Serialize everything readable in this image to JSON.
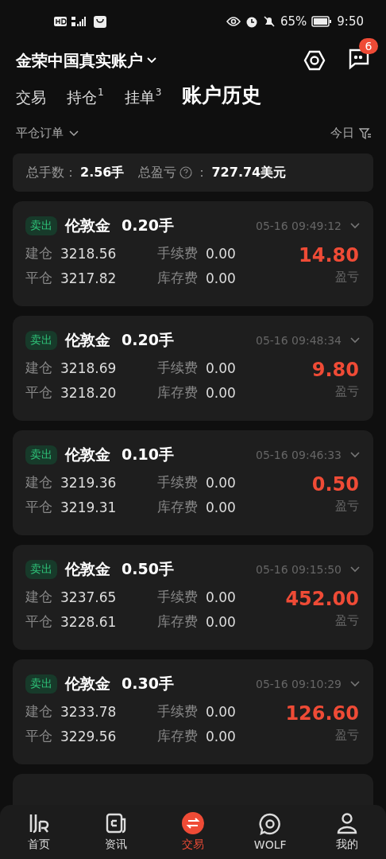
{
  "status_bar": {
    "battery": "65%",
    "time": "9:50"
  },
  "header": {
    "account": "金荣中国真实账户",
    "message_count": "6"
  },
  "tabs": [
    {
      "label": "交易",
      "selected": false
    },
    {
      "label": "持仓",
      "badge": "1",
      "selected": false
    },
    {
      "label": "挂单",
      "badge": "3",
      "selected": false
    },
    {
      "label": "账户历史",
      "selected": true
    }
  ],
  "filter": {
    "order_type": "平仓订单",
    "period": "今日"
  },
  "summary": {
    "lots_label": "总手数：",
    "lots": "2.56手",
    "pnl_label": "总盈亏",
    "pnl_sep": "：",
    "pnl": "727.74美元"
  },
  "orders": [
    {
      "side": "卖出",
      "kind": "sell",
      "symbol": "伦敦金",
      "lots": "0.20手",
      "time": "05-16 09:49:12",
      "open_label": "建仓",
      "open": "3218.56",
      "close_label": "平仓",
      "close": "3217.82",
      "fee_label": "手续费",
      "fee": "0.00",
      "swap_label": "库存费",
      "swap": "0.00",
      "pnl": "14.80",
      "pnl_label": "盈亏"
    },
    {
      "side": "卖出",
      "kind": "sell",
      "symbol": "伦敦金",
      "lots": "0.20手",
      "time": "05-16 09:48:34",
      "open_label": "建仓",
      "open": "3218.69",
      "close_label": "平仓",
      "close": "3218.20",
      "fee_label": "手续费",
      "fee": "0.00",
      "swap_label": "库存费",
      "swap": "0.00",
      "pnl": "9.80",
      "pnl_label": "盈亏"
    },
    {
      "side": "卖出",
      "kind": "sell",
      "symbol": "伦敦金",
      "lots": "0.10手",
      "time": "05-16 09:46:33",
      "open_label": "建仓",
      "open": "3219.36",
      "close_label": "平仓",
      "close": "3219.31",
      "fee_label": "手续费",
      "fee": "0.00",
      "swap_label": "库存费",
      "swap": "0.00",
      "pnl": "0.50",
      "pnl_label": "盈亏"
    },
    {
      "side": "卖出",
      "kind": "sell",
      "symbol": "伦敦金",
      "lots": "0.50手",
      "time": "05-16 09:15:50",
      "open_label": "建仓",
      "open": "3237.65",
      "close_label": "平仓",
      "close": "3228.61",
      "fee_label": "手续费",
      "fee": "0.00",
      "swap_label": "库存费",
      "swap": "0.00",
      "pnl": "452.00",
      "pnl_label": "盈亏"
    },
    {
      "side": "卖出",
      "kind": "sell",
      "symbol": "伦敦金",
      "lots": "0.30手",
      "time": "05-16 09:10:29",
      "open_label": "建仓",
      "open": "3233.78",
      "close_label": "平仓",
      "close": "3229.56",
      "fee_label": "手续费",
      "fee": "0.00",
      "swap_label": "库存费",
      "swap": "0.00",
      "pnl": "126.60",
      "pnl_label": "盈亏"
    }
  ],
  "nav": [
    {
      "label": "首页",
      "kind": "home",
      "selected": false
    },
    {
      "label": "资讯",
      "kind": "news",
      "selected": false
    },
    {
      "label": "交易",
      "kind": "trade",
      "selected": true
    },
    {
      "label": "WOLF",
      "kind": "wolf",
      "selected": false
    },
    {
      "label": "我的",
      "kind": "me",
      "selected": false
    }
  ]
}
